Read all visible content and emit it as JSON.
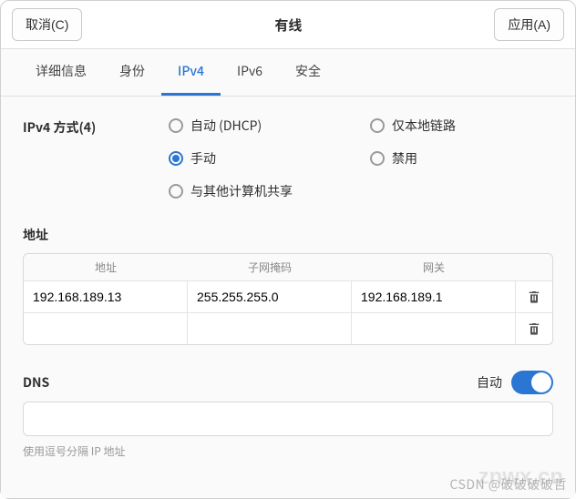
{
  "header": {
    "cancel": "取消(C)",
    "title": "有线",
    "apply": "应用(A)"
  },
  "tabs": {
    "details": "详细信息",
    "identity": "身份",
    "ipv4": "IPv4",
    "ipv6": "IPv6",
    "security": "安全"
  },
  "ipv4": {
    "method_label": "IPv4 方式(4)",
    "methods": {
      "auto": "自动 (DHCP)",
      "link_local": "仅本地链路",
      "manual": "手动",
      "disabled": "禁用",
      "shared": "与其他计算机共享"
    },
    "selected_method": "manual"
  },
  "addresses": {
    "section": "地址",
    "headers": {
      "address": "地址",
      "netmask": "子网掩码",
      "gateway": "网关"
    },
    "rows": [
      {
        "address": "192.168.189.13",
        "netmask": "255.255.255.0",
        "gateway": "192.168.189.1"
      },
      {
        "address": "",
        "netmask": "",
        "gateway": ""
      }
    ]
  },
  "dns": {
    "label": "DNS",
    "auto_label": "自动",
    "auto_on": true,
    "value": "",
    "hint": "使用逗号分隔 IP 地址"
  },
  "watermark": {
    "csdn": "CSDN @破破破破哲",
    "logo": "znwx.cn"
  }
}
